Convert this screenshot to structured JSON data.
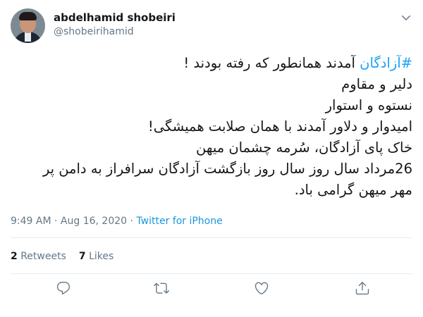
{
  "author": {
    "display_name": "abdelhamid shobeiri",
    "handle": "@shobeirihamid"
  },
  "icons": {
    "menu": "chevron-down-icon",
    "reply": "reply-icon",
    "retweet": "retweet-icon",
    "like": "heart-icon",
    "share": "share-icon"
  },
  "tweet": {
    "hashtag": "#آزادگان",
    "first_line_rest": " آمدند همانطور که رفته بودند !",
    "lines": [
      "دلیر و مقاوم",
      "نستوه و استوار",
      "امیدوار و دلاور آمدند با همان صلابت همیشگی!",
      "خاک پای آزادگان، سُرمه چشمان میهن",
      "26مرداد سال روز سال روز بازگشت آزادگان سرافراز به دامن پر",
      "مهر میهن گرامی باد."
    ]
  },
  "meta": {
    "time": "9:49 AM",
    "separator": " · ",
    "date": "Aug 16, 2020",
    "source": "Twitter for iPhone"
  },
  "stats": {
    "retweets_count": "2",
    "retweets_label": " Retweets",
    "likes_count": "7",
    "likes_label": " Likes"
  },
  "colors": {
    "accent": "#1da1f2",
    "muted": "#657786",
    "text": "#14171a",
    "divider": "#e6ecf0"
  }
}
